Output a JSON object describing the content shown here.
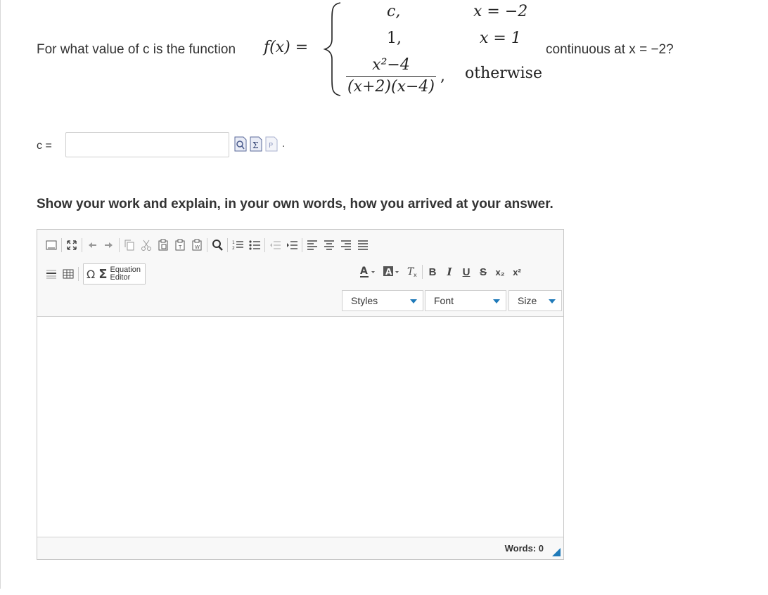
{
  "question": {
    "prefix": "For what value of c is the function",
    "fx": "f(x) =",
    "cases": [
      {
        "value": "c,",
        "condition": "x = −2"
      },
      {
        "value": "1,",
        "condition": "x = 1"
      },
      {
        "value_numerator": "x²−4",
        "value_denominator": "(x+2)(x−4)",
        "value_suffix": ",",
        "condition": "otherwise"
      }
    ],
    "suffix": "continuous at x = −2?"
  },
  "answer": {
    "label": "c =",
    "value": "",
    "placeholder": "",
    "trailing": "."
  },
  "prompt": "Show your work and explain, in your own words, how you arrived at your answer.",
  "editor": {
    "equation_editor_line1": "Equation",
    "equation_editor_line2": "Editor",
    "styles_label": "Styles",
    "font_label": "Font",
    "size_label": "Size",
    "words_label": "Words: 0",
    "format_buttons": {
      "bold": "B",
      "italic": "I",
      "underline": "U",
      "strike": "S",
      "subscript": "x₂",
      "superscript": "x²",
      "omega": "Ω",
      "sigma": "Σ"
    }
  },
  "colors": {
    "accent": "#1f7ab9",
    "border": "#c7c7c7",
    "toolbar_bg": "#f8f8f8"
  }
}
